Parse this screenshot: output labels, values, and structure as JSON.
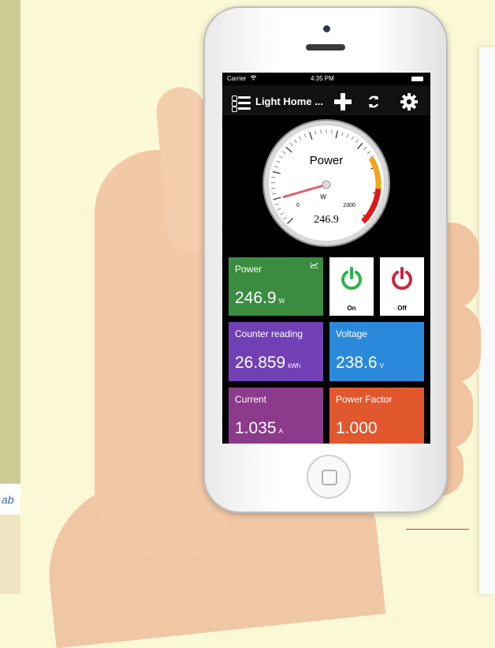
{
  "sidebar": {
    "tab_text": "ab"
  },
  "status_bar": {
    "carrier": "Carrier",
    "time": "4:35 PM"
  },
  "navbar": {
    "title": "Light Home ..."
  },
  "gauge": {
    "title": "Power",
    "unit": "W",
    "min_label": "0",
    "max_label": "2300",
    "value_text": "246.9",
    "value": 246.9,
    "max": 2300
  },
  "tiles": {
    "power": {
      "label": "Power",
      "value": "246.9",
      "unit": "W"
    },
    "counter": {
      "label": "Counter reading",
      "value": "26.859",
      "unit": "kWh"
    },
    "voltage": {
      "label": "Voltage",
      "value": "238.6",
      "unit": "V"
    },
    "current": {
      "label": "Current",
      "value": "1.035",
      "unit": "A"
    },
    "power_factor": {
      "label": "Power Factor",
      "value": "1.000"
    }
  },
  "switches": {
    "on_label": "On",
    "off_label": "Off"
  },
  "colors": {
    "power_tile": "#3a8d40",
    "counter_tile": "#7140b5",
    "voltage_tile": "#2b89db",
    "current_tile": "#8c3a8c",
    "pf_tile": "#e2582e",
    "on_icon": "#2db34a",
    "off_icon": "#c8273e"
  },
  "icons": [
    "list-menu-icon",
    "plus-icon",
    "sync-icon",
    "gear-icon",
    "chart-icon",
    "power-on-icon",
    "power-off-icon",
    "wifi-icon",
    "battery-icon"
  ]
}
